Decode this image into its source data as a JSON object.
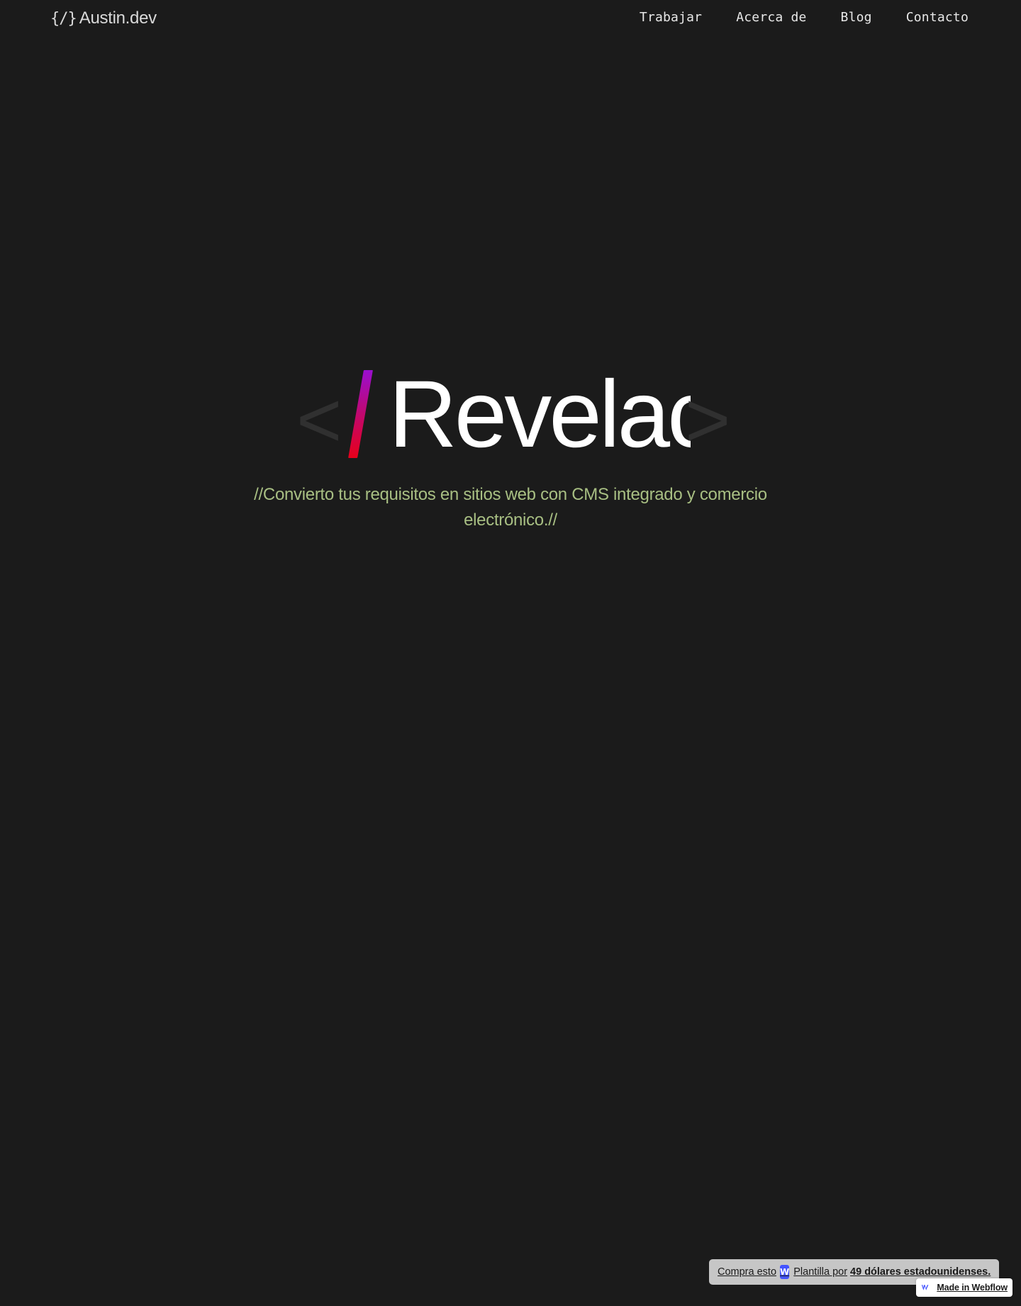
{
  "header": {
    "logo_icon": "{/}",
    "logo_text": "Austin.dev",
    "nav": [
      {
        "label": "Trabajar"
      },
      {
        "label": "Acerca de"
      },
      {
        "label": "Blog"
      },
      {
        "label": "Contacto"
      }
    ]
  },
  "hero": {
    "bracket_open": "<",
    "bracket_close": ">",
    "title": "Revelac",
    "subtitle_line1": "//Convierto tus requisitos en sitios web con CMS integrado y comercio",
    "subtitle_line2": "electrónico.//"
  },
  "buy_badge": {
    "prefix": "Compra esto",
    "logo_letter": "W",
    "middle": "Plantilla por",
    "price": "49 dólares estadounidenses."
  },
  "webflow_badge": {
    "label": "Made in Webflow"
  },
  "colors": {
    "background": "#1b1b1b",
    "subtitle": "#a8bf83",
    "slash_top": "#9a0fd0",
    "slash_bottom": "#e8001a",
    "webflow_blue": "#4353ff"
  }
}
